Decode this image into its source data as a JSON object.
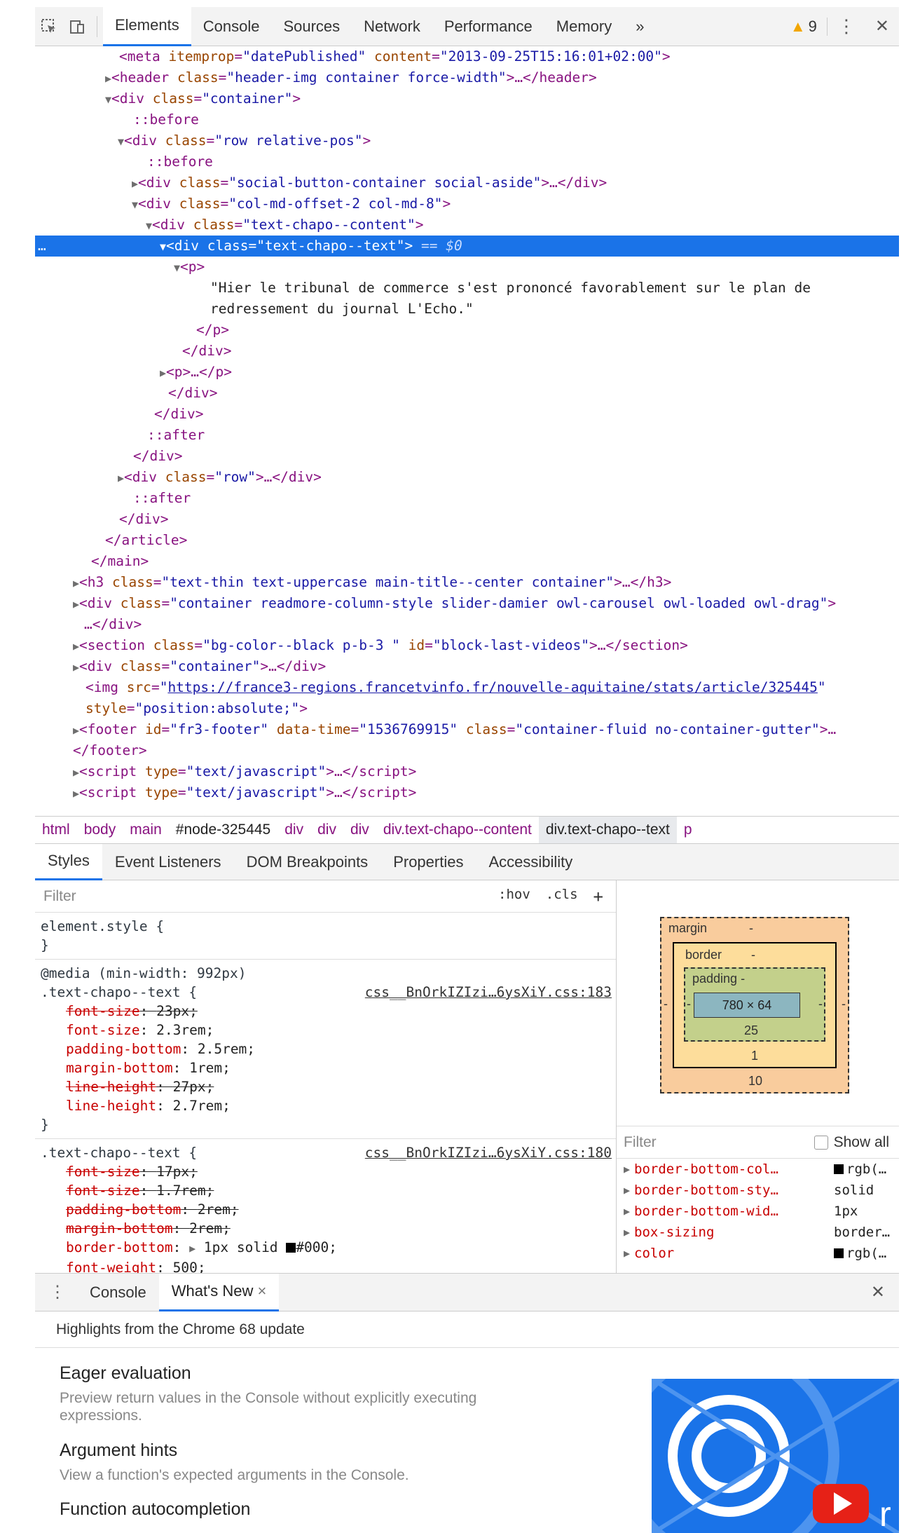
{
  "toolbar": {
    "tabs": [
      "Elements",
      "Console",
      "Sources",
      "Network",
      "Performance",
      "Memory"
    ],
    "more": "»",
    "warning_count": "9",
    "menu": "⋮",
    "close": "✕"
  },
  "tree": {
    "l1": {
      "attr1": "itemprop",
      "val1": "\"datePublished\"",
      "attr2": "content",
      "val2": "\"2013-09-25T15:16:01+02:00\""
    },
    "l2": {
      "val": "\"header-img container force-width\""
    },
    "l3": {
      "val": "\"container\""
    },
    "before": "::before",
    "after": "::after",
    "l5": {
      "val": "\"row relative-pos\""
    },
    "l7": {
      "val": "\"social-button-container social-aside\""
    },
    "l8": {
      "val": "\"col-md-offset-2 col-md-8\""
    },
    "l9": {
      "val": "\"text-chapo--content\""
    },
    "l10": {
      "val": "\"text-chapo--text\"",
      "eq": "== $0"
    },
    "text1": "\"Hier le tribunal de commerce s'est prononcé favorablement sur le plan de",
    "text2": "redressement du journal L'Echo.\"",
    "l21": {
      "val": "\"row\""
    },
    "l27": {
      "val": "\"text-thin text-uppercase main-title--center container\""
    },
    "l28": {
      "val": "\"container readmore-column-style slider-damier owl-carousel owl-loaded owl-drag\""
    },
    "l30": {
      "val1": "\"bg-color--black p-b-3 \"",
      "val2": "\"block-last-videos\""
    },
    "l31": {
      "val": "\"container\""
    },
    "l32": {
      "url": "https://france3-regions.francetvinfo.fr/nouvelle-aquitaine/stats/article/325445"
    },
    "l33": {
      "val": "\"position:absolute;\""
    },
    "l34": {
      "val1": "\"fr3-footer\"",
      "val2": "\"1536769915\"",
      "val3": "\"container-fluid no-container-gutter\""
    },
    "script_type": "\"text/javascript\""
  },
  "breadcrumbs": [
    "html",
    "body",
    "main",
    "#node-325445",
    "div",
    "div",
    "div",
    "div.text-chapo--content",
    "div.text-chapo--text",
    "p"
  ],
  "subtabs": [
    "Styles",
    "Event Listeners",
    "DOM Breakpoints",
    "Properties",
    "Accessibility"
  ],
  "styles": {
    "filter_placeholder": "Filter",
    "hov": ":hov",
    "cls": ".cls",
    "plus": "+",
    "element_style": "element.style {",
    "close_brace": "}",
    "media": "@media (min-width: 992px)",
    "rule1_selector": ".text-chapo--text {",
    "rule1_src": "css__BnOrkIZIzi…6ysXiY.css:183",
    "rule1_props": [
      {
        "name": "font-size",
        "value": "23px;",
        "strike": true
      },
      {
        "name": "font-size",
        "value": "2.3rem;",
        "strike": false
      },
      {
        "name": "padding-bottom",
        "value": "2.5rem;",
        "strike": false
      },
      {
        "name": "margin-bottom",
        "value": "1rem;",
        "strike": false
      },
      {
        "name": "line-height",
        "value": "27px;",
        "strike": true
      },
      {
        "name": "line-height",
        "value": "2.7rem;",
        "strike": false
      }
    ],
    "rule2_selector": ".text-chapo--text {",
    "rule2_src": "css__BnOrkIZIzi…6ysXiY.css:180",
    "rule2_props": [
      {
        "name": "font-size",
        "value": "17px;",
        "strike": true
      },
      {
        "name": "font-size",
        "value": "1.7rem;",
        "strike": true
      },
      {
        "name": "padding-bottom",
        "value": "2rem;",
        "strike": true
      },
      {
        "name": "margin-bottom",
        "value": "2rem;",
        "strike": true
      }
    ],
    "border_bottom_name": "border-bottom",
    "border_bottom_value": "1px solid",
    "border_bottom_color": "#000;",
    "font_weight_name": "font-weight",
    "font_weight_value": "500;"
  },
  "boxmodel": {
    "margin_label": "margin",
    "margin_top": "-",
    "margin_left": "-",
    "margin_right": "-",
    "margin_bottom": "10",
    "border_label": "border",
    "border_top": "-",
    "border_bottom": "1",
    "padding_label": "padding -",
    "padding_bottom": "25",
    "padding_left": "-",
    "padding_right": "-",
    "content": "780 × 64"
  },
  "computed": {
    "filter_placeholder": "Filter",
    "show_all": "Show all",
    "rows": [
      {
        "name": "border-bottom-col…",
        "value": "rgb(…",
        "swatch": true
      },
      {
        "name": "border-bottom-sty…",
        "value": "solid",
        "swatch": false
      },
      {
        "name": "border-bottom-wid…",
        "value": "1px",
        "swatch": false
      },
      {
        "name": "box-sizing",
        "value": "border…",
        "swatch": false
      },
      {
        "name": "color",
        "value": "rgb(…",
        "swatch": true
      }
    ]
  },
  "drawer": {
    "tabs": [
      "Console",
      "What's New"
    ],
    "tab_close": "×",
    "close": "✕",
    "highlights": "Highlights from the Chrome 68 update",
    "features": [
      {
        "title": "Eager evaluation",
        "desc1": "Preview return values in the Console without explicitly executing",
        "desc2": "expressions."
      },
      {
        "title": "Argument hints",
        "desc1": "View a function's expected arguments in the Console.",
        "desc2": ""
      },
      {
        "title": "Function autocompletion",
        "desc1": "",
        "desc2": ""
      }
    ]
  },
  "colors": {
    "accent": "#1a73e8",
    "tag": "#881280",
    "attr": "#994500",
    "value": "#1a1aa6",
    "prop": "#c80000"
  }
}
